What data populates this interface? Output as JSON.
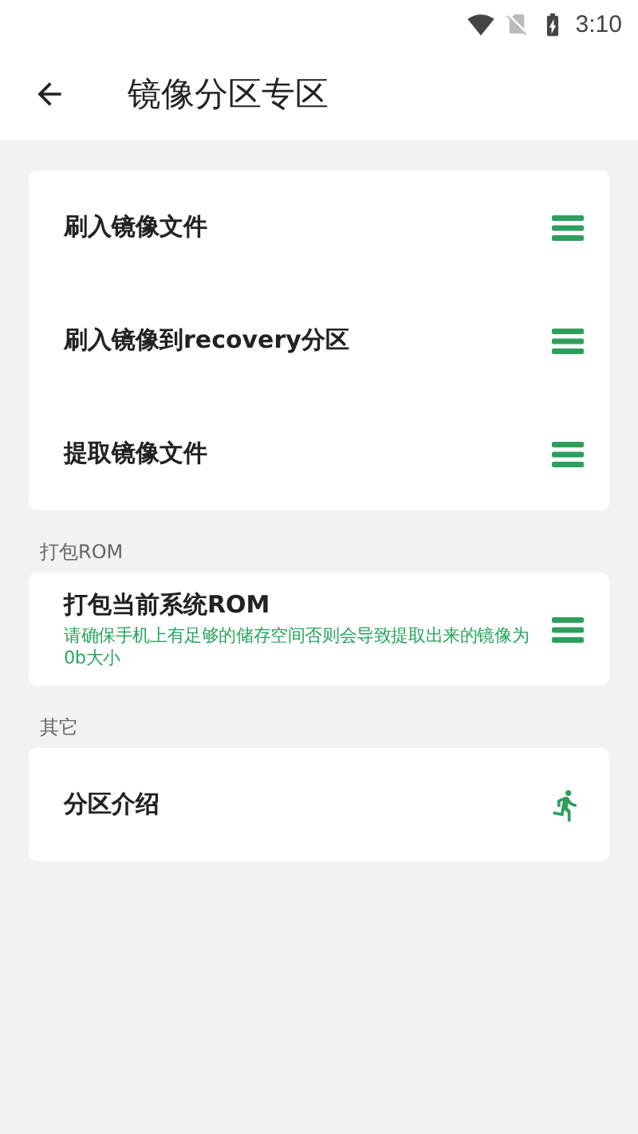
{
  "status_bar": {
    "time": "3:10"
  },
  "app_bar": {
    "title": "镜像分区专区"
  },
  "sections": [
    {
      "items": [
        {
          "title": "刷入镜像文件",
          "kind": "menu"
        },
        {
          "title": "刷入镜像到recovery分区",
          "kind": "menu"
        },
        {
          "title": "提取镜像文件",
          "kind": "menu"
        }
      ]
    },
    {
      "header": "打包ROM",
      "items": [
        {
          "title": "打包当前系统ROM",
          "subtitle": "请确保手机上有足够的储存空间否则会导致提取出来的镜像为0b大小",
          "kind": "menu"
        }
      ]
    },
    {
      "header": "其它",
      "items": [
        {
          "title": "分区介绍",
          "kind": "run"
        }
      ]
    }
  ]
}
